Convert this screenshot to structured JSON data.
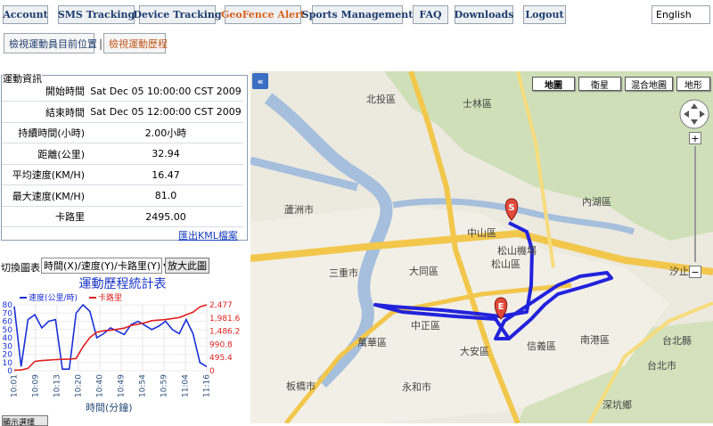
{
  "nav": {
    "items": [
      "Account",
      "SMS Tracking",
      "Device Tracking",
      "GeoFence Alert",
      "Sports Management",
      "FAQ",
      "Downloads",
      "Logout"
    ],
    "active_index": 3,
    "language": "English"
  },
  "subtabs": {
    "current_position": "檢視運動員目前位置",
    "separator": "|",
    "history": "檢視運動歷程"
  },
  "info": {
    "title": "運動資訊",
    "rows": [
      {
        "label": "開始時間",
        "value": "Sat Dec 05 10:00:00 CST 2009"
      },
      {
        "label": "結束時間",
        "value": "Sat Dec 05 12:00:00 CST 2009"
      },
      {
        "label": "持續時間(小時)",
        "value": "2.00小時"
      },
      {
        "label": "距離(公里)",
        "value": "32.94"
      },
      {
        "label": "平均速度(KM/H)",
        "value": "16.47"
      },
      {
        "label": "最大速度(KM/H)",
        "value": "81.0"
      },
      {
        "label": "卡路里",
        "value": "2495.00"
      }
    ],
    "kml_link": "匯出KML檔案"
  },
  "chart_controls": {
    "switch_label": "切換圖表:",
    "select_value": "時間(X)/速度(Y)/卡路里(Y)",
    "zoom_button": "放大此圖",
    "cut_button": "顯示選擇"
  },
  "chart_data": {
    "type": "line",
    "title": "運動歷程統計表",
    "xlabel": "時間(分鐘)",
    "categories": [
      "10:01",
      "10:09",
      "10:13",
      "10:20",
      "10:40",
      "10:49",
      "10:54",
      "10:59",
      "11:04",
      "11:16"
    ],
    "left_axis": {
      "ticks": [
        "0",
        "10",
        "20",
        "30",
        "40",
        "50",
        "60",
        "70",
        "80"
      ],
      "ylim": [
        0,
        80
      ]
    },
    "right_axis": {
      "ticks": [
        "0",
        "495.4",
        "990.8",
        "1,486.2",
        "1,981.6",
        "2,477"
      ],
      "ylim": [
        0,
        2477
      ]
    },
    "series": [
      {
        "name": "速度(公里/時)",
        "color": "#1a2fd6",
        "axis": "left",
        "values": [
          78,
          5,
          62,
          68,
          52,
          60,
          62,
          2,
          2,
          70,
          80,
          72,
          40,
          45,
          52,
          48,
          44,
          56,
          60,
          55,
          50,
          54,
          60,
          50,
          45,
          62,
          45,
          10,
          5
        ]
      },
      {
        "name": "卡路里",
        "color": "#e02020",
        "axis": "right",
        "values": [
          20,
          30,
          90,
          350,
          380,
          400,
          420,
          430,
          440,
          460,
          900,
          1250,
          1450,
          1500,
          1520,
          1560,
          1600,
          1700,
          1750,
          1800,
          1880,
          1900,
          1920,
          1960,
          2000,
          2100,
          2200,
          2400,
          2477
        ]
      }
    ]
  },
  "map": {
    "types": [
      "地圖",
      "衛星",
      "混合地圖",
      "地形"
    ],
    "active_type": 0,
    "collapse_icon": "«",
    "districts": [
      "北投區",
      "士林區",
      "內湖區",
      "中山區",
      "松山區",
      "松山機場",
      "大同區",
      "三重市",
      "蘆洲市",
      "中正區",
      "萬華區",
      "大安區",
      "信義區",
      "南港區",
      "汐止市",
      "板橋市",
      "永和市",
      "深坑鄉",
      "台北縣",
      "台北市"
    ],
    "marker_start": "S",
    "marker_end": "E"
  }
}
